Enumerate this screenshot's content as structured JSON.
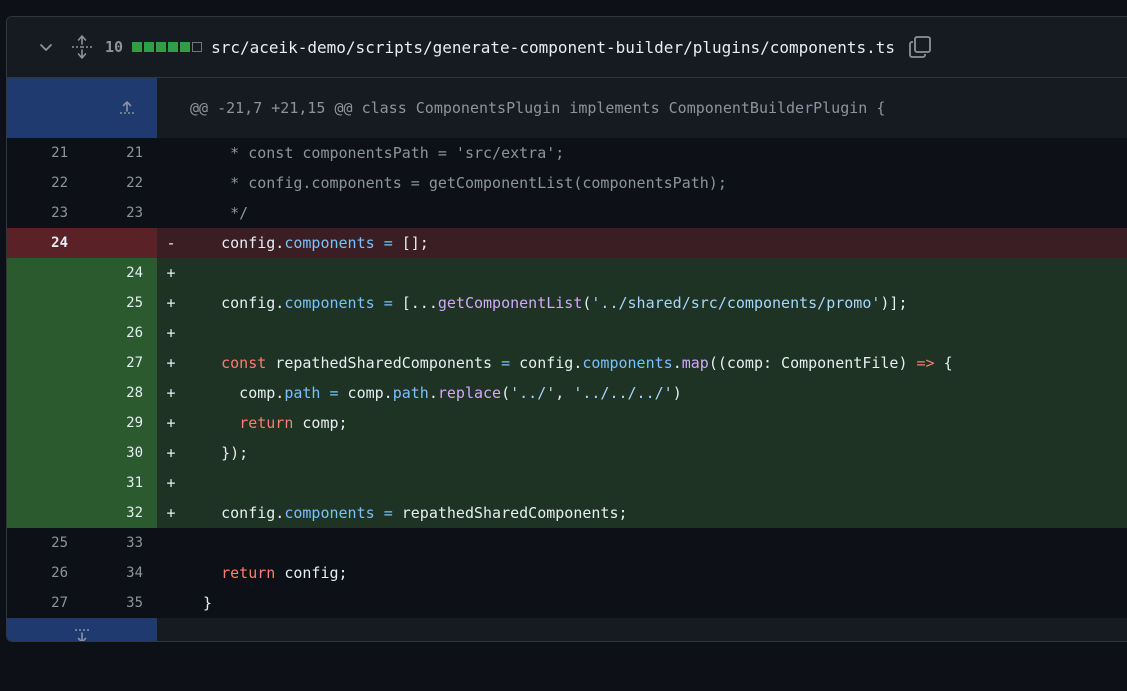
{
  "file": {
    "change_count": "10",
    "path": "src/aceik-demo/scripts/generate-component-builder/plugins/components.ts",
    "diffstat": [
      "add",
      "add",
      "add",
      "add",
      "add",
      "neutral"
    ],
    "colors": {
      "addition": "#2ea043",
      "deletion_line": "#5a2227",
      "addition_line": "#2a5a2e",
      "hunk_expander": "#1f3a6e"
    }
  },
  "hunk": {
    "header": "@@ -21,7 +21,15 @@ class ComponentsPlugin implements ComponentBuilderPlugin {"
  },
  "lines": [
    {
      "type": "context",
      "old": "21",
      "new": "21",
      "marker": "",
      "tokens": [
        [
          "c",
          "     * const componentsPath = 'src/extra';"
        ]
      ]
    },
    {
      "type": "context",
      "old": "22",
      "new": "22",
      "marker": "",
      "tokens": [
        [
          "c",
          "     * config.components = getComponentList(componentsPath);"
        ]
      ]
    },
    {
      "type": "context",
      "old": "23",
      "new": "23",
      "marker": "",
      "tokens": [
        [
          "c",
          "     */"
        ]
      ]
    },
    {
      "type": "del",
      "old": "24",
      "new": "",
      "marker": "-",
      "tokens": [
        [
          "t",
          "    config."
        ],
        [
          "p",
          "components"
        ],
        [
          "t",
          " "
        ],
        [
          "p",
          "="
        ],
        [
          "t",
          " [];"
        ]
      ]
    },
    {
      "type": "add",
      "old": "",
      "new": "24",
      "marker": "+",
      "tokens": []
    },
    {
      "type": "add",
      "old": "",
      "new": "25",
      "marker": "+",
      "tokens": [
        [
          "t",
          "    config."
        ],
        [
          "p",
          "components"
        ],
        [
          "t",
          " "
        ],
        [
          "p",
          "="
        ],
        [
          "t",
          " [..."
        ],
        [
          "f",
          "getComponentList"
        ],
        [
          "t",
          "("
        ],
        [
          "s",
          "'../shared/src/components/promo'"
        ],
        [
          "t",
          ")];"
        ]
      ]
    },
    {
      "type": "add",
      "old": "",
      "new": "26",
      "marker": "+",
      "tokens": []
    },
    {
      "type": "add",
      "old": "",
      "new": "27",
      "marker": "+",
      "tokens": [
        [
          "t",
          "    "
        ],
        [
          "k",
          "const"
        ],
        [
          "t",
          " repathedSharedComponents "
        ],
        [
          "p",
          "="
        ],
        [
          "t",
          " config."
        ],
        [
          "p",
          "components"
        ],
        [
          "t",
          "."
        ],
        [
          "f",
          "map"
        ],
        [
          "t",
          "((comp: ComponentFile) "
        ],
        [
          "k",
          "=>"
        ],
        [
          "t",
          " {"
        ]
      ]
    },
    {
      "type": "add",
      "old": "",
      "new": "28",
      "marker": "+",
      "tokens": [
        [
          "t",
          "      comp."
        ],
        [
          "p",
          "path"
        ],
        [
          "t",
          " "
        ],
        [
          "p",
          "="
        ],
        [
          "t",
          " comp."
        ],
        [
          "p",
          "path"
        ],
        [
          "t",
          "."
        ],
        [
          "f",
          "replace"
        ],
        [
          "t",
          "("
        ],
        [
          "s",
          "'../'"
        ],
        [
          "t",
          ", "
        ],
        [
          "s",
          "'../../../'"
        ],
        [
          "t",
          ")"
        ]
      ]
    },
    {
      "type": "add",
      "old": "",
      "new": "29",
      "marker": "+",
      "tokens": [
        [
          "t",
          "      "
        ],
        [
          "k",
          "return"
        ],
        [
          "t",
          " comp;"
        ]
      ]
    },
    {
      "type": "add",
      "old": "",
      "new": "30",
      "marker": "+",
      "tokens": [
        [
          "t",
          "    });"
        ]
      ]
    },
    {
      "type": "add",
      "old": "",
      "new": "31",
      "marker": "+",
      "tokens": []
    },
    {
      "type": "add",
      "old": "",
      "new": "32",
      "marker": "+",
      "tokens": [
        [
          "t",
          "    config."
        ],
        [
          "p",
          "components"
        ],
        [
          "t",
          " "
        ],
        [
          "p",
          "="
        ],
        [
          "t",
          " repathedSharedComponents;"
        ]
      ]
    },
    {
      "type": "context",
      "old": "25",
      "new": "33",
      "marker": "",
      "tokens": []
    },
    {
      "type": "context",
      "old": "26",
      "new": "34",
      "marker": "",
      "tokens": [
        [
          "t",
          "    "
        ],
        [
          "k",
          "return"
        ],
        [
          "t",
          " config;"
        ]
      ]
    },
    {
      "type": "context",
      "old": "27",
      "new": "35",
      "marker": "",
      "tokens": [
        [
          "t",
          "  }"
        ]
      ]
    }
  ]
}
